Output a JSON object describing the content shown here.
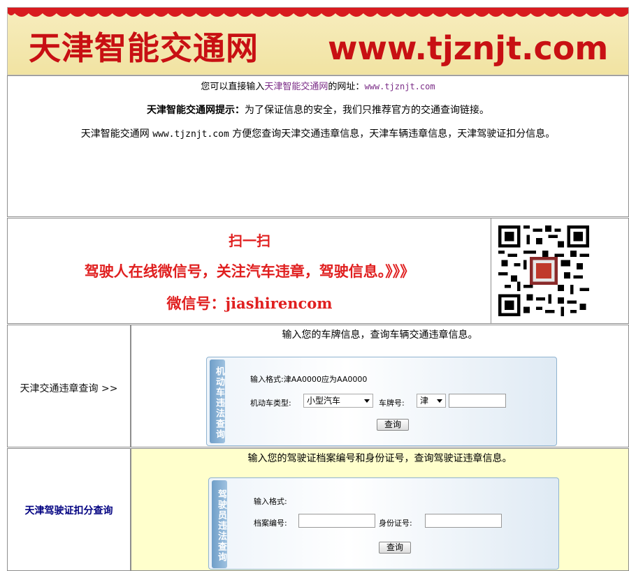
{
  "banner": {
    "title": "天津智能交通网",
    "url": "www.tjznjt.com"
  },
  "info": {
    "line1_prefix": "您可以直接输入",
    "line1_link": "天津智能交通网",
    "line1_mid": "的网址：",
    "line1_url": "www.tjznjt.com",
    "tip_label": "天津智能交通网提示：",
    "tip_text": "为了保证信息的安全，我们只推荐官方的交通查询链接。",
    "desc_prefix": "天津智能交通网 ",
    "desc_url": "www.tjznjt.com",
    "desc_rest": " 方便您查询天津交通违章信息，天津车辆违章信息，天津驾驶证扣分信息。"
  },
  "wechat": {
    "scan": "扫一扫",
    "follow": "驾驶人在线微信号，关注汽车违章，驾驶信息。》》》",
    "wxid": "微信号：jiashirencom",
    "qr_icon": "qr-code-icon"
  },
  "vehicle_query": {
    "left_label": "天津交通违章查询 >>",
    "caption": "输入您的车牌信息，查询车辆交通违章信息。",
    "tab": "机动车违法查询",
    "format_label": "输入格式:津AA0000应为AA0000",
    "type_label": "机动车类型:",
    "type_value": "小型汽车",
    "plate_label": "车牌号:",
    "plate_prefix": "津",
    "plate_value": "",
    "submit": "查询"
  },
  "license_query": {
    "left_label": "天津驾驶证扣分查询",
    "caption": "输入您的驾驶证档案编号和身份证号，查询驾驶证违章信息。",
    "tab": "驾驶员违法查询",
    "format_label": "输入格式:",
    "file_label": "档案编号:",
    "file_value": "",
    "id_label": "身份证号:",
    "id_value": "",
    "submit": "查询"
  },
  "colors": {
    "brand_red": "#c81013",
    "wechat_red": "#e01f1f",
    "link_purple": "#7b2d87",
    "license_bg": "#ffffcc",
    "license_label": "#000080"
  }
}
